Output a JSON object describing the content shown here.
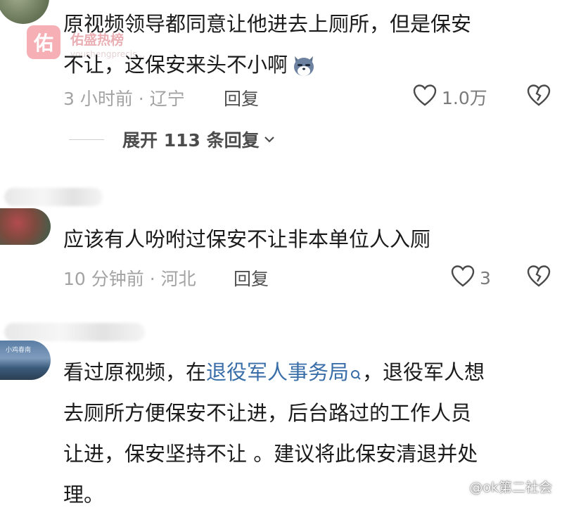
{
  "watermark": {
    "logo_char": "佑",
    "name": "佑盛热榜",
    "subtitle": "youshengprecis…"
  },
  "comments": [
    {
      "text_lines": [
        "原视频领导都同意让他进去上厕所，但是保安",
        "不让，这保安来头不小啊"
      ],
      "emoji": "wolf-emoji",
      "time_location": "3 小时前 · 辽宁",
      "reply_label": "回复",
      "likes": "1.0万",
      "expand_label": "展开 113 条回复"
    },
    {
      "text_lines": [
        "应该有人吩咐过保安不让非本单位人入厕"
      ],
      "time_location": "10 分钟前 · 河北",
      "reply_label": "回复",
      "likes": "3"
    },
    {
      "avatar_text": "小鸡春南",
      "text_parts": {
        "prefix": "看过原视频，在",
        "link": "退役军人事务局",
        "suffix": "，退役军人想"
      },
      "text_lines": [
        "去厕所方便保安不让进，后台路过的工作人员",
        "让进，保安坚持不让 。建议将此保安清退并处",
        "理。"
      ]
    }
  ],
  "credit": "@ok第二社会",
  "colors": {
    "meta_gray": "#a3a3a3",
    "link_blue": "#3a6ea8",
    "text_dark": "#1b1b1b",
    "watermark_pink": "#f4a7ad"
  }
}
